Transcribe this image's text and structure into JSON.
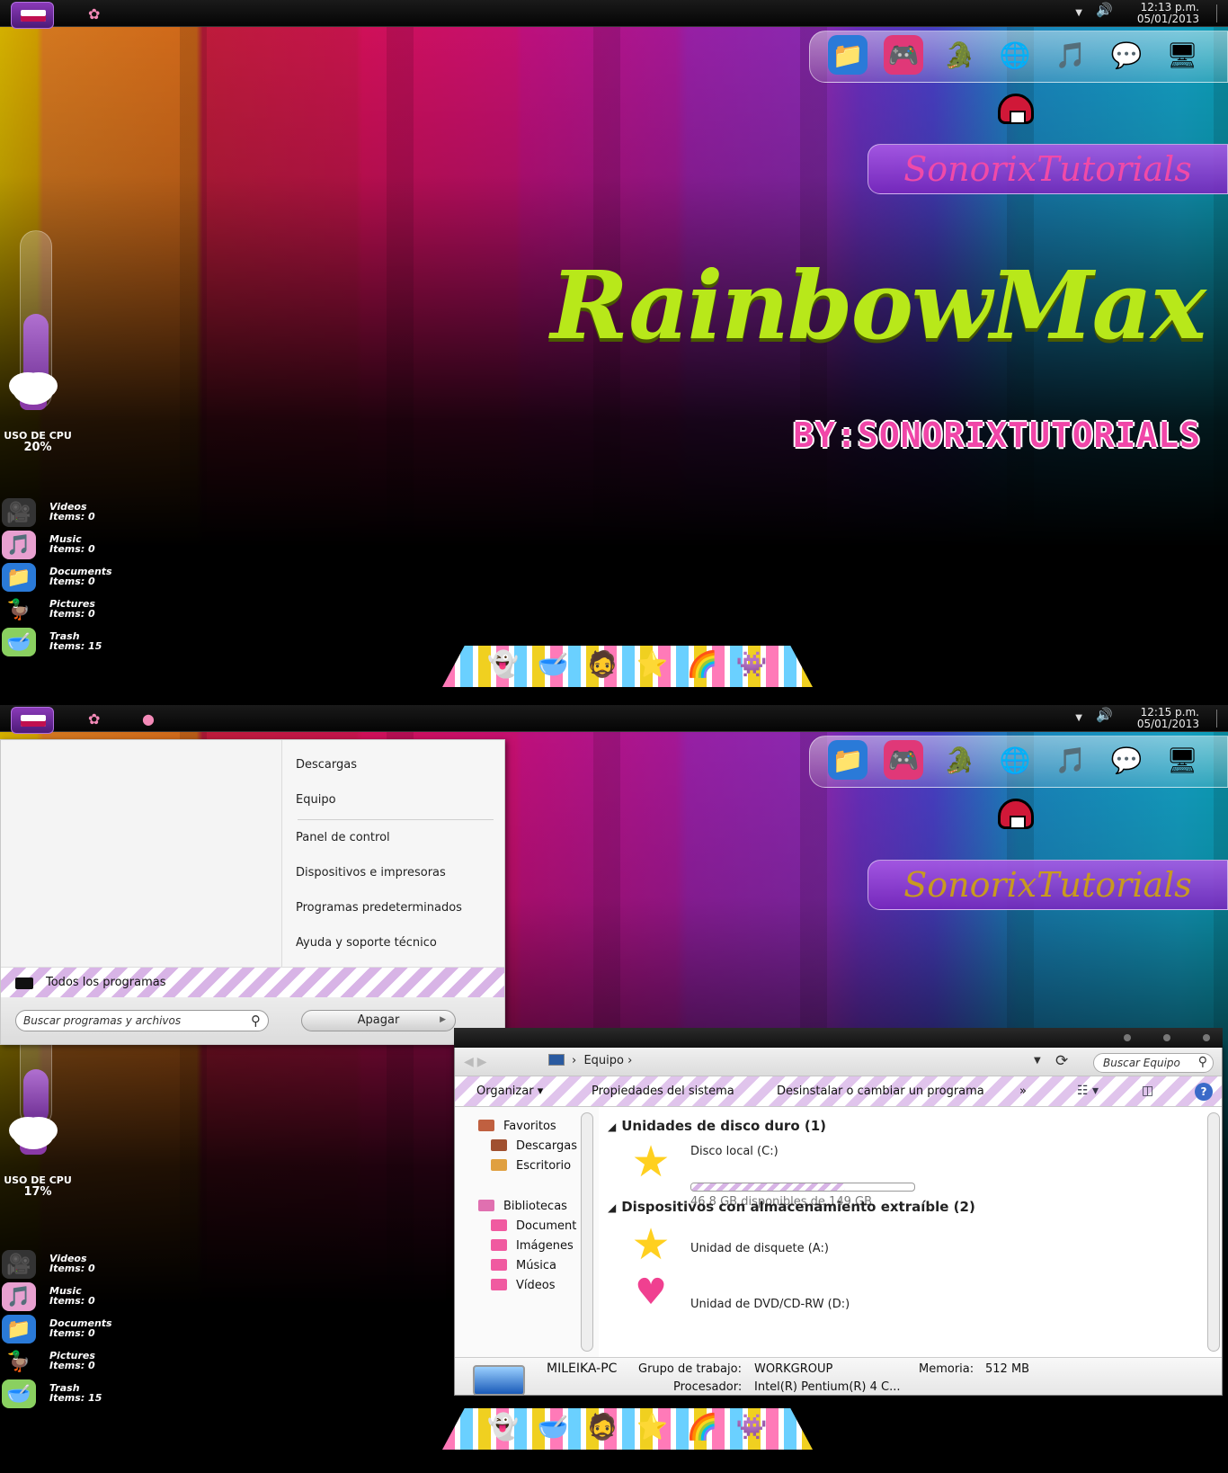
{
  "screens": [
    {
      "time": "12:13 p.m.",
      "date": "05/01/2013",
      "cpu_label": "USO DE CPU",
      "cpu_value": "20%",
      "cpu_level": 0.2
    },
    {
      "time": "12:15 p.m.",
      "date": "05/01/2013",
      "cpu_label": "USO DE CPU",
      "cpu_value": "17%",
      "cpu_level": 0.17
    }
  ],
  "banner": "SonorixTutorials",
  "title": "RainbowMax",
  "subtitle": "BY:SONORIXTUTORIALS",
  "side_items": [
    {
      "name": "Videos",
      "items": "Items: 0",
      "icon": "video-camera-icon"
    },
    {
      "name": "Music",
      "items": "Items: 0",
      "icon": "music-disc-icon"
    },
    {
      "name": "Documents",
      "items": "Items: 0",
      "icon": "documents-folder-icon"
    },
    {
      "name": "Pictures",
      "items": "Items: 0",
      "icon": "duck-icon"
    },
    {
      "name": "Trash",
      "items": "Items: 15",
      "icon": "trash-bowl-icon"
    }
  ],
  "top_dock_icons": [
    "folder-icon",
    "gameboy-icon",
    "crocodile-icon",
    "globe-icon",
    "itunes-icon",
    "chat-icon",
    "monitor-icon"
  ],
  "bottom_dock_icons": [
    "ghost-icon",
    "bowl-icon",
    "caveman-icon",
    "star-icon",
    "rainbow-cloud-icon",
    "monster-icon"
  ],
  "start_menu": {
    "right_items_top": [
      "Descargas",
      "Equipo"
    ],
    "right_items_bottom": [
      "Panel de control",
      "Dispositivos e impresoras",
      "Programas predeterminados",
      "Ayuda y soporte técnico"
    ],
    "all_programs": "Todos los programas",
    "search_placeholder": "Buscar programas y archivos",
    "shutdown": "Apagar"
  },
  "explorer": {
    "address": "Equipo",
    "search_placeholder": "Buscar Equipo",
    "toolbar": {
      "organize": "Organizar",
      "system_properties": "Propiedades del sistema",
      "uninstall": "Desinstalar o cambiar un programa",
      "more": "»"
    },
    "nav": {
      "favorites": "Favoritos",
      "downloads": "Descargas",
      "desktop": "Escritorio",
      "libraries": "Bibliotecas",
      "documents": "Document",
      "images": "Imágenes",
      "music": "Música",
      "videos": "Vídeos"
    },
    "groups": {
      "hard_drives": "Unidades de disco duro (1)",
      "removable": "Dispositivos con almacenamiento extraíble (2)"
    },
    "drives": {
      "c_name": "Disco local (C:)",
      "c_free": "46.8 GB disponibles de 149 GB",
      "c_used_fraction": 0.69,
      "a_name": "Unidad de disquete (A:)",
      "d_name": "Unidad de DVD/CD-RW (D:)"
    },
    "details": {
      "pc_name": "MILEIKA-PC",
      "workgroup_label": "Grupo de trabajo:",
      "workgroup": "WORKGROUP",
      "memory_label": "Memoria:",
      "memory": "512 MB",
      "processor_label": "Procesador:",
      "processor": "Intel(R) Pentium(R) 4 C..."
    }
  },
  "colors": {
    "title": "#b8e81a",
    "subtitle": "#f046a8",
    "banner_text_1": "#f04aa8",
    "banner_text_2": "#c89a20"
  }
}
